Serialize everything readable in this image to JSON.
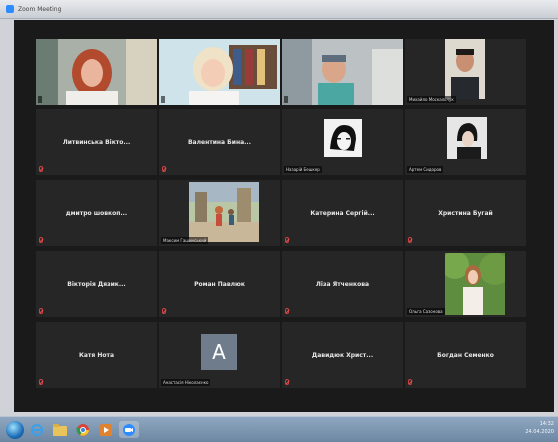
{
  "window": {
    "title": "Zoom Meeting"
  },
  "participants": [
    {
      "name": "",
      "video": true
    },
    {
      "name": "",
      "video": true
    },
    {
      "name": "",
      "video": true
    },
    {
      "name": "Михайло Москальчук",
      "video": true
    },
    {
      "name": "Литвинська Вікто...",
      "video": false
    },
    {
      "name": "Валентина Бина...",
      "video": false
    },
    {
      "name": "Назарій Бешкер",
      "avatar": "photo"
    },
    {
      "name": "Артем Сидоров",
      "avatar": "photo"
    },
    {
      "name": "дмитро шовкоп...",
      "video": false
    },
    {
      "name": "Максим Гашинський",
      "avatar": "photo"
    },
    {
      "name": "Катерина Сергій...",
      "video": false
    },
    {
      "name": "Христина Бугай",
      "video": false
    },
    {
      "name": "Вікторія Дязик...",
      "video": false
    },
    {
      "name": "Роман Павлюк",
      "video": false
    },
    {
      "name": "Ліза Ятченкова",
      "video": false
    },
    {
      "name": "Ольга Сазонова",
      "avatar": "photo"
    },
    {
      "name": "Катя Нота",
      "video": false
    },
    {
      "name": "Анастасія Ніколаєнко",
      "avatar": "letter",
      "letter": "A"
    },
    {
      "name": "Давидюк Христ...",
      "video": false
    },
    {
      "name": "Богдан Семенко",
      "video": false
    }
  ],
  "taskbar": {
    "apps": [
      "windows-start",
      "ie-icon",
      "folder-icon",
      "chrome-icon",
      "media-icon",
      "zoom-icon"
    ],
    "clock_time": "14:32",
    "clock_date": "24.04.2020"
  },
  "colors": {
    "active_speaker": "#d8c25a",
    "tile_bg": "#262626",
    "avatar_bg": "#6e7c8c"
  }
}
